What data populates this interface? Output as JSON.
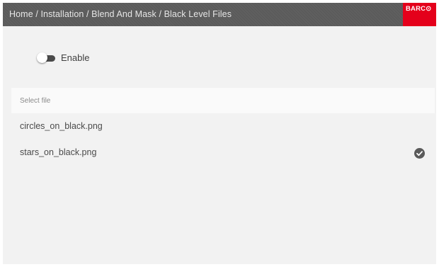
{
  "header": {
    "breadcrumb": "Home / Installation / Blend And Mask / Black Level Files",
    "logo": "BARC⊙",
    "logo_color": "#e4001b",
    "background_color": "#5b5b5b"
  },
  "enable_toggle": {
    "label": "Enable",
    "state": "off"
  },
  "file_list": {
    "header_label": "Select file",
    "items": [
      {
        "name": "circles_on_black.png",
        "selected": false
      },
      {
        "name": "stars_on_black.png",
        "selected": true,
        "icon": "check-circle-icon"
      }
    ]
  }
}
